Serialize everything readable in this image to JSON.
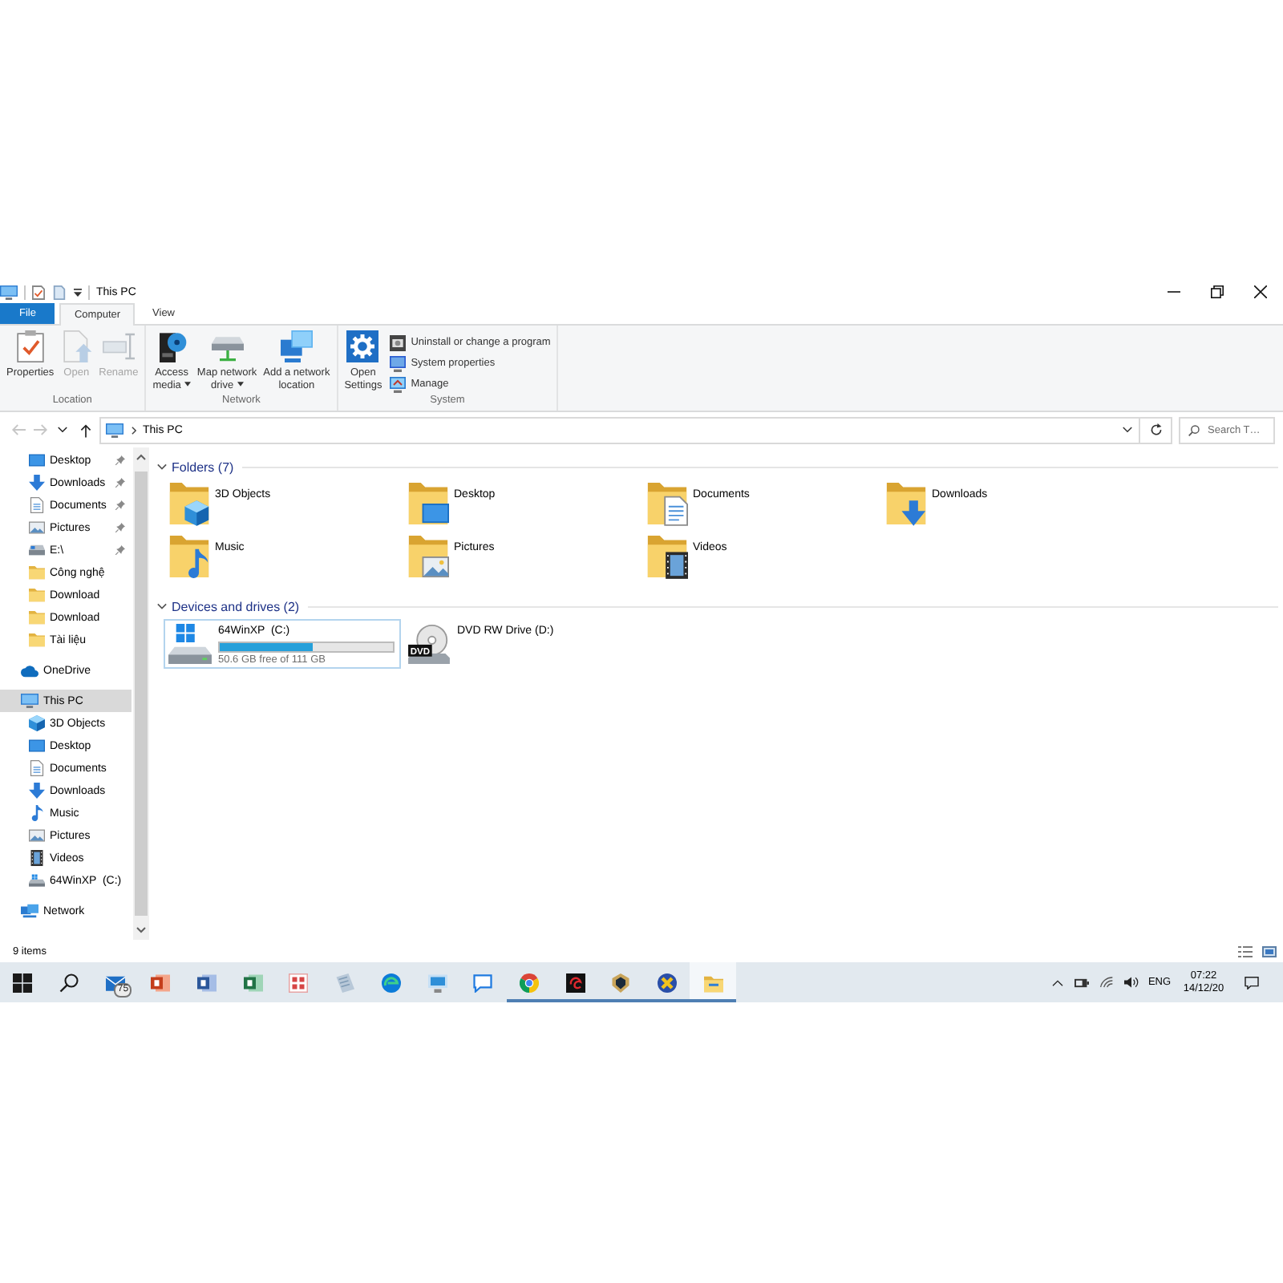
{
  "window": {
    "title": "This PC"
  },
  "ribbon": {
    "tabs": [
      {
        "label": "File",
        "kind": "file",
        "selected": false
      },
      {
        "label": "Computer",
        "kind": "tab",
        "selected": true
      },
      {
        "label": "View",
        "kind": "tab",
        "selected": false
      }
    ],
    "groups": [
      {
        "label": "Location",
        "buttons": [
          {
            "label": "Properties",
            "kind": "properties",
            "disabled": false
          },
          {
            "label": "Open",
            "kind": "open",
            "disabled": true
          },
          {
            "label": "Rename",
            "kind": "rename",
            "disabled": true
          }
        ]
      },
      {
        "label": "Network",
        "buttons": [
          {
            "label": "Access\nmedia",
            "kind": "media",
            "disabled": false,
            "dropdown": true
          },
          {
            "label": "Map network\ndrive",
            "kind": "map_drive",
            "disabled": false,
            "dropdown": true
          },
          {
            "label": "Add a network\nlocation",
            "kind": "add_location",
            "disabled": false
          }
        ]
      },
      {
        "label": "System",
        "buttons": [
          {
            "label": "Open\nSettings",
            "kind": "settings",
            "disabled": false
          }
        ],
        "small_buttons": [
          {
            "label": "Uninstall or change a program",
            "kind": "uninstall",
            "disabled": false
          },
          {
            "label": "System properties",
            "kind": "system_properties",
            "disabled": false
          },
          {
            "label": "Manage",
            "kind": "manage",
            "disabled": false
          }
        ]
      }
    ]
  },
  "navigation": [
    {
      "kind": "back",
      "disabled": true
    },
    {
      "kind": "forward",
      "disabled": true
    },
    {
      "kind": "recent",
      "disabled": false
    },
    {
      "kind": "up",
      "disabled": false
    }
  ],
  "address_bar": {
    "path": [
      {
        "label": "This PC"
      }
    ]
  },
  "search": {
    "placeholder": "Search T…"
  },
  "sidebar": {
    "quick_access": [
      {
        "label": "Desktop",
        "kind": "desktop",
        "pinned": true,
        "selected": false
      },
      {
        "label": "Downloads",
        "kind": "downloads",
        "pinned": true,
        "selected": false
      },
      {
        "label": "Documents",
        "kind": "documents",
        "pinned": true,
        "selected": false
      },
      {
        "label": "Pictures",
        "kind": "pictures",
        "pinned": true,
        "selected": false
      },
      {
        "label": "E:\\",
        "kind": "drive",
        "pinned": true,
        "selected": false
      },
      {
        "label": "Công nghệ",
        "kind": "folder",
        "pinned": false,
        "selected": false
      },
      {
        "label": "Download",
        "kind": "folder",
        "pinned": false,
        "selected": false
      },
      {
        "label": "Download",
        "kind": "folder",
        "pinned": false,
        "selected": false
      },
      {
        "label": "Tài liệu",
        "kind": "folder",
        "pinned": false,
        "selected": false
      }
    ],
    "tree": [
      {
        "label": "OneDrive",
        "kind": "cloud",
        "selected": false
      },
      {
        "label": "This PC",
        "kind": "pc",
        "selected": true,
        "children": [
          {
            "label": "3D Objects",
            "kind": "objects",
            "selected": false
          },
          {
            "label": "Desktop",
            "kind": "desktop",
            "selected": false
          },
          {
            "label": "Documents",
            "kind": "documents",
            "selected": false
          },
          {
            "label": "Downloads",
            "kind": "downloads",
            "selected": false
          },
          {
            "label": "Music",
            "kind": "music",
            "selected": false
          },
          {
            "label": "Pictures",
            "kind": "pictures",
            "selected": false
          },
          {
            "label": "Videos",
            "kind": "videos",
            "selected": false
          },
          {
            "label": "64WinXP  (C:)",
            "kind": "hdd",
            "selected": false
          }
        ]
      },
      {
        "label": "Network",
        "kind": "network",
        "selected": false
      }
    ]
  },
  "sections": [
    {
      "title": "Folders (7)",
      "kind": "folders",
      "expanded": true,
      "items": [
        {
          "label": "3D Objects",
          "kind": "objects"
        },
        {
          "label": "Desktop",
          "kind": "desktop"
        },
        {
          "label": "Documents",
          "kind": "documents"
        },
        {
          "label": "Downloads",
          "kind": "downloads"
        },
        {
          "label": "Music",
          "kind": "music"
        },
        {
          "label": "Pictures",
          "kind": "pictures"
        },
        {
          "label": "Videos",
          "kind": "videos"
        }
      ]
    },
    {
      "title": "Devices and drives (2)",
      "kind": "drives",
      "expanded": true,
      "items": [
        {
          "label": "64WinXP  (C:)",
          "kind": "hdd",
          "highlighted": true,
          "level": 0.54,
          "detail": "50.6 GB free of 111 GB"
        },
        {
          "label": "DVD RW Drive (D:)",
          "kind": "dvd",
          "highlighted": false,
          "icon_text": "DVD"
        }
      ]
    }
  ],
  "status_bar": {
    "text": "9 items"
  },
  "taskbar": {
    "items": [
      {
        "kind": "start",
        "running": false,
        "active": false
      },
      {
        "kind": "search",
        "running": false,
        "active": false
      },
      {
        "kind": "mail",
        "running": false,
        "active": false,
        "badge": "75"
      },
      {
        "kind": "presentation",
        "running": false,
        "active": false
      },
      {
        "kind": "word",
        "running": false,
        "active": false
      },
      {
        "kind": "spreadsheet",
        "running": false,
        "active": false
      },
      {
        "kind": "glyphs",
        "running": false,
        "active": false
      },
      {
        "kind": "notepad",
        "running": false,
        "active": false
      },
      {
        "kind": "edge",
        "running": false,
        "active": false
      },
      {
        "kind": "monitor",
        "running": false,
        "active": false
      },
      {
        "kind": "chat",
        "running": false,
        "active": false
      },
      {
        "kind": "chrome",
        "running": true,
        "active": false
      },
      {
        "kind": "swirl",
        "running": true,
        "active": false
      },
      {
        "kind": "emblem",
        "running": true,
        "active": false
      },
      {
        "kind": "x_circle",
        "running": true,
        "active": false
      },
      {
        "kind": "explorer",
        "running": true,
        "active": true
      }
    ],
    "tray": {
      "language": "ENG",
      "time": "07:22",
      "date": "14/12/20"
    }
  }
}
